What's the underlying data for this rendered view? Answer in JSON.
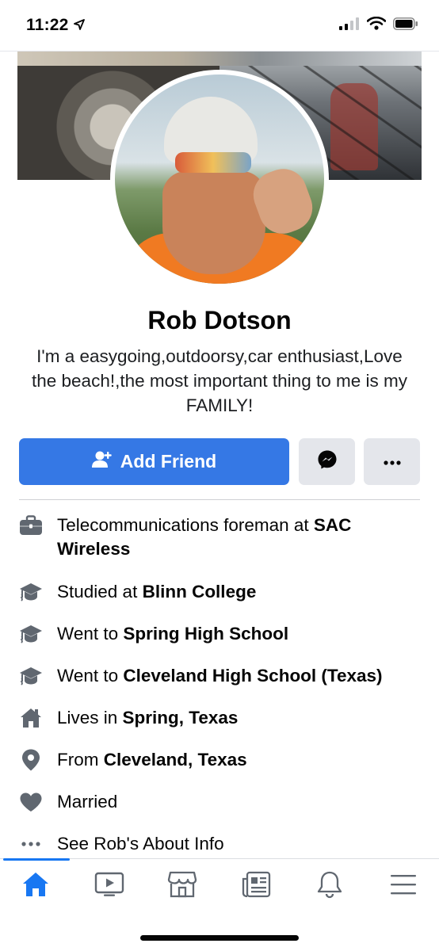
{
  "status_bar": {
    "time": "11:22",
    "icons": [
      "location-arrow-icon",
      "signal-icon",
      "wifi-icon",
      "battery-icon"
    ]
  },
  "profile": {
    "name": "Rob Dotson",
    "bio": "I'm a easygoing,outdoorsy,car enthusiast,Love the beach!,the most important thing to me is my FAMILY!"
  },
  "actions": {
    "add_friend_label": "Add Friend",
    "add_friend_icon": "add-friend-icon",
    "messenger_icon": "messenger-icon",
    "more_icon": "more-icon"
  },
  "about": {
    "items": [
      {
        "icon": "briefcase-icon",
        "prefix": "Telecommunications foreman at ",
        "bold": "SAC Wireless"
      },
      {
        "icon": "graduation-cap-icon",
        "prefix": "Studied at ",
        "bold": "Blinn College"
      },
      {
        "icon": "graduation-cap-icon",
        "prefix": "Went to ",
        "bold": "Spring High School"
      },
      {
        "icon": "graduation-cap-icon",
        "prefix": "Went to ",
        "bold": "Cleveland High School (Texas)"
      },
      {
        "icon": "home-icon",
        "prefix": "Lives in ",
        "bold": "Spring, Texas"
      },
      {
        "icon": "location-pin-icon",
        "prefix": "From ",
        "bold": "Cleveland, Texas"
      },
      {
        "icon": "heart-icon",
        "prefix": "Married",
        "bold": ""
      },
      {
        "icon": "more-dots-icon",
        "prefix": "See Rob's About Info",
        "bold": ""
      }
    ]
  },
  "tabbar": {
    "tabs": [
      "home-icon",
      "watch-icon",
      "marketplace-icon",
      "news-icon",
      "notifications-icon",
      "menu-icon"
    ],
    "active": "home-icon",
    "accent_color": "#1877f2"
  },
  "colors": {
    "primary_button": "#3578e5",
    "secondary_button": "#e4e6eb",
    "icon_gray": "#606770"
  }
}
